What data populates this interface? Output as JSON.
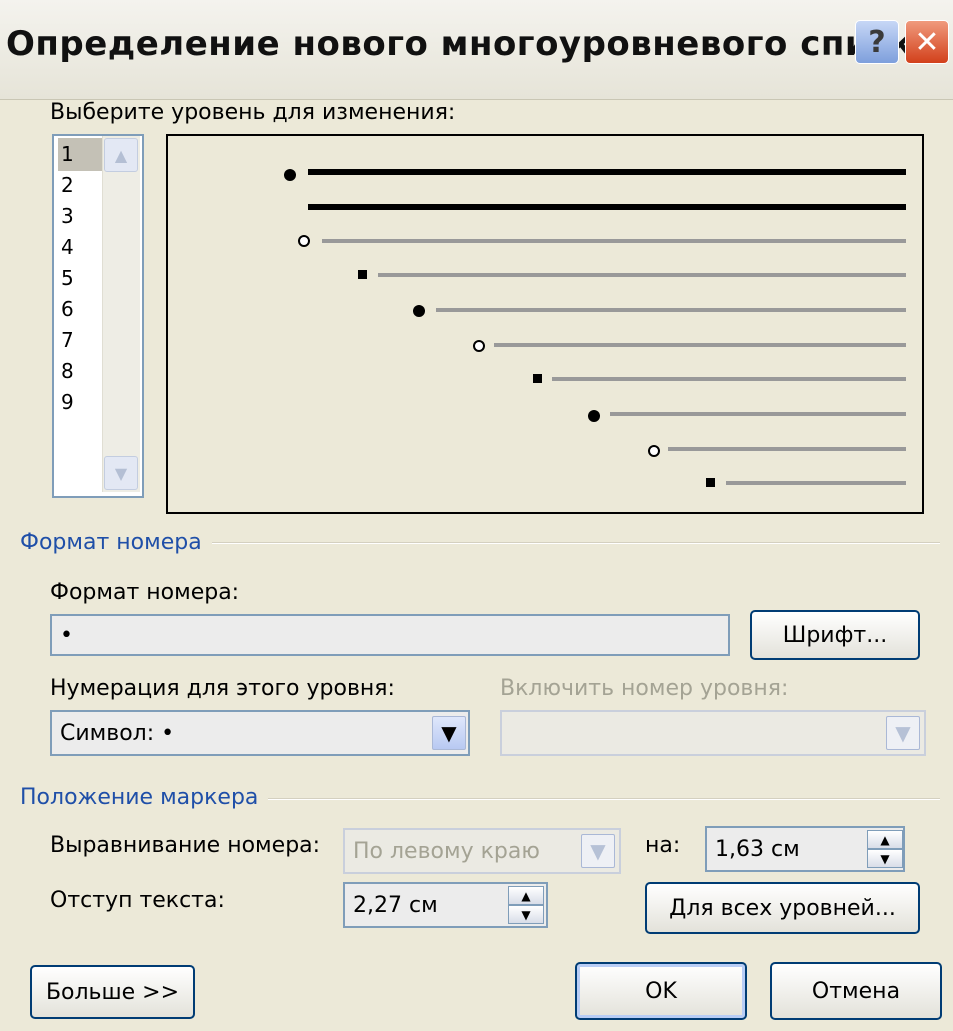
{
  "window": {
    "title": "Определение нового многоуровневого списка",
    "help_label": "?",
    "close_label": "✕"
  },
  "level_label": "Выберите уровень для изменения:",
  "levels": [
    "1",
    "2",
    "3",
    "4",
    "5",
    "6",
    "7",
    "8",
    "9"
  ],
  "selected_level": "1",
  "preview_markers": [
    "dot",
    "none",
    "circle",
    "square",
    "dot",
    "circle",
    "square",
    "dot",
    "circle",
    "square"
  ],
  "number_format_group": "Формат номера",
  "number_format_label": "Формат номера:",
  "number_format_value": "•",
  "font_button": "Шрифт...",
  "numbering_label": "Нумерация для этого уровня:",
  "numbering_value": "Символ: •",
  "include_level_label": "Включить номер уровня:",
  "include_level_value": "",
  "position_group": "Положение маркера",
  "alignment_label": "Выравнивание номера:",
  "alignment_value": "По левому краю",
  "at_label": "на:",
  "at_value": "1,63 см",
  "indent_label": "Отступ текста:",
  "indent_value": "2,27 см",
  "all_levels_button": "Для всех уровней...",
  "more_button": "Больше >>",
  "ok_button": "OK",
  "cancel_button": "Отмена",
  "colors": {
    "group_heading": "#1f4fa8",
    "dialog_bg": "#ece9d8"
  }
}
